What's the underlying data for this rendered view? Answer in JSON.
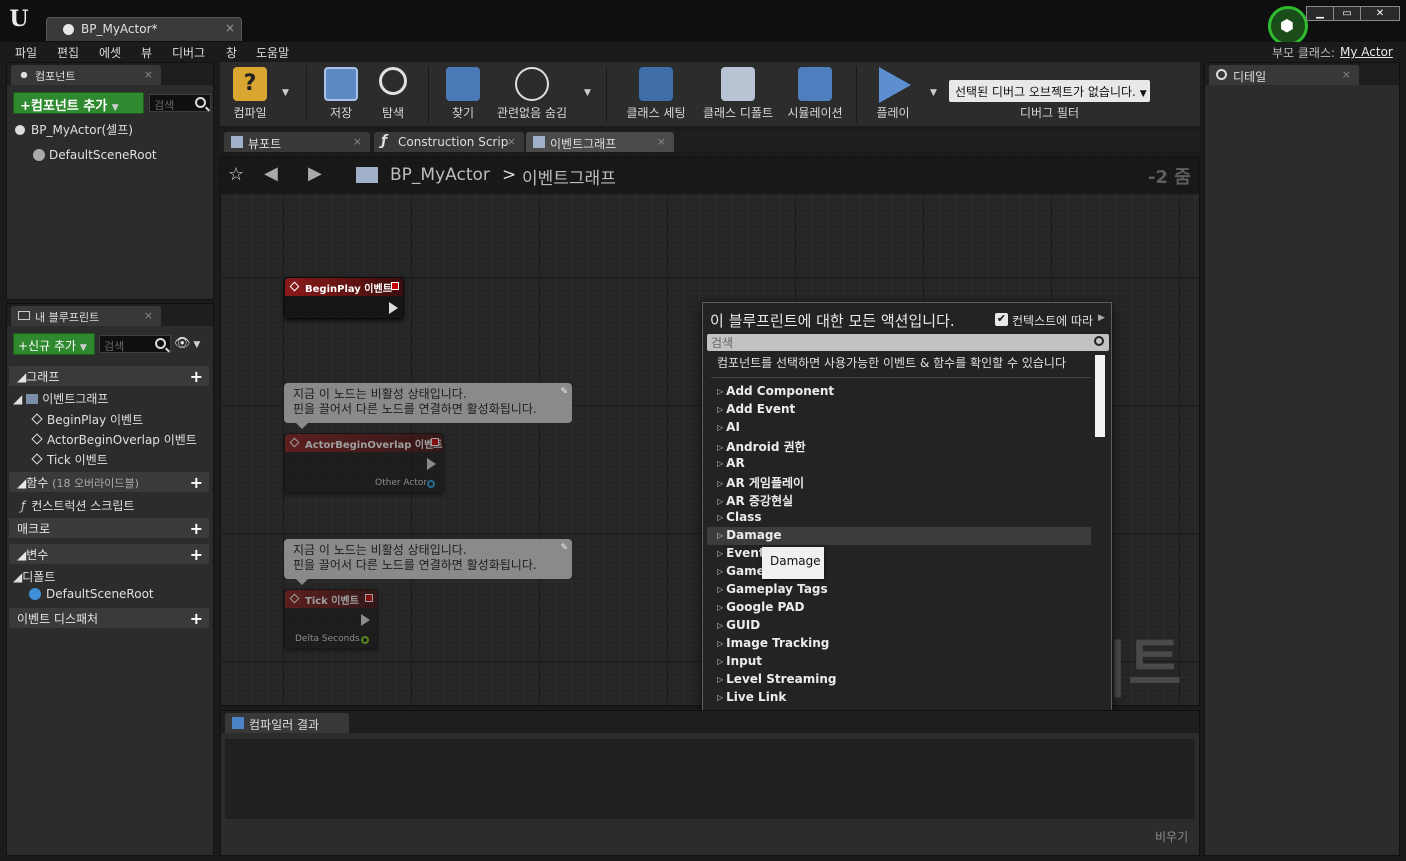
{
  "window": {
    "tab_title": "BP_MyActor*",
    "tab_close": "×",
    "minimize": "▁",
    "maximize": "▭",
    "close": "✕"
  },
  "menu": [
    "파일",
    "편집",
    "에셋",
    "뷰",
    "디버그",
    "창",
    "도움말"
  ],
  "parent_class": {
    "label": "부모 클래스:",
    "value": "My Actor"
  },
  "components_panel": {
    "tab": "컴포넌트",
    "add_button": "+컴포넌트 추가",
    "search_placeholder": "검색",
    "items": [
      "BP_MyActor(셀프)",
      "DefaultSceneRoot"
    ]
  },
  "my_blueprint": {
    "tab": "내 블루프린트",
    "add_button": "+신규 추가",
    "search_placeholder": "검색",
    "graphs": {
      "label": "그래프",
      "event_graph": "이벤트그래프",
      "events": [
        "BeginPlay 이벤트",
        "ActorBeginOverlap 이벤트",
        "Tick 이벤트"
      ]
    },
    "functions": {
      "label": "함수",
      "count": "(18 오버라이드블)",
      "items": [
        "컨스트럭션 스크립트"
      ]
    },
    "macros": "매크로",
    "variables": "변수",
    "defaults": {
      "label": "디폴트",
      "items": [
        "DefaultSceneRoot"
      ]
    },
    "dispatchers": "이벤트 디스패처"
  },
  "toolbar": {
    "compile": "컴파일",
    "save": "저장",
    "browse": "탐색",
    "find": "찾기",
    "hide_unrelated": "관련없음 숨김",
    "class_settings": "클래스 세팅",
    "class_defaults": "클래스 디폴트",
    "simulation": "시뮬레이션",
    "play": "플레이",
    "debug_selector": "선택된 디버그 오브젝트가 없습니다.",
    "debug_filter": "디버그 필터"
  },
  "editor_tabs": [
    "뷰포트",
    "Construction Scrip",
    "이벤트그래프"
  ],
  "graph": {
    "breadcrumb_root": "BP_MyActor",
    "breadcrumb_sep": ">",
    "breadcrumb_current": "이벤트그래프",
    "zoom": "-2 줌",
    "watermark": "|트",
    "nodes": {
      "begin_play": "BeginPlay 이벤트",
      "overlap": "ActorBeginOverlap 이벤트",
      "overlap_pin": "Other Actor",
      "tick": "Tick 이벤트",
      "tick_pin": "Delta Seconds"
    },
    "comment_line1": "지금 이 노드는 비활성 상태입니다.",
    "comment_line2": "핀을 끌어서 다른 노드를 연결하면 활성화됩니다."
  },
  "action_menu": {
    "title": "이 블루프린트에 대한 모든 액션입니다.",
    "context_label": "컨텍스트에 따라",
    "search_placeholder": "검색",
    "hint": "컴포넌트를 선택하면 사용가능한 이벤트 & 함수를 확인할 수 있습니다",
    "categories": [
      "Add Component",
      "Add Event",
      "AI",
      "Android 권한",
      "AR",
      "AR 게임플레이",
      "AR 증강현실",
      "Class",
      "Damage",
      "Event D",
      "Game",
      "Gameplay Tags",
      "Google PAD",
      "GUID",
      "Image Tracking",
      "Input",
      "Level Streaming",
      "Live Link"
    ],
    "tooltip": "Damage"
  },
  "compiler": {
    "tab": "컴파일러 결과",
    "clear": "비우기"
  },
  "details": {
    "tab": "디테일"
  },
  "colors": {
    "accent_green": "#2f8a2f",
    "event_red": "#8b1a1a",
    "selection": "#3c3c3c"
  }
}
